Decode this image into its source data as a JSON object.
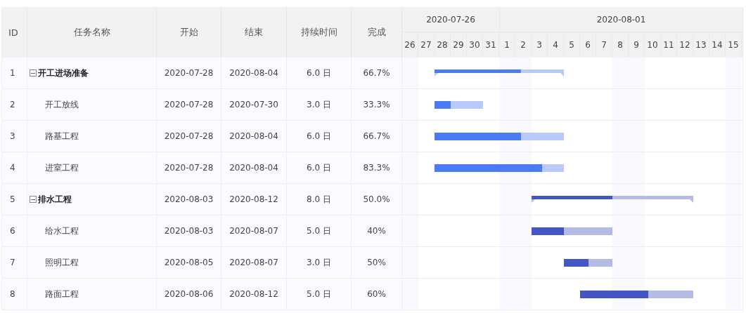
{
  "columns": [
    "ID",
    "任务名称",
    "开始",
    "结束",
    "持续时间",
    "完成"
  ],
  "timeline": {
    "weeks": [
      "2020-07-26",
      "2020-08-01"
    ],
    "days": [
      {
        "label": "26",
        "weekend": true
      },
      {
        "label": "27",
        "weekend": false
      },
      {
        "label": "28",
        "weekend": false
      },
      {
        "label": "29",
        "weekend": false
      },
      {
        "label": "30",
        "weekend": false
      },
      {
        "label": "31",
        "weekend": false
      },
      {
        "label": "1",
        "weekend": true
      },
      {
        "label": "2",
        "weekend": true
      },
      {
        "label": "3",
        "weekend": false
      },
      {
        "label": "4",
        "weekend": false
      },
      {
        "label": "5",
        "weekend": false
      },
      {
        "label": "6",
        "weekend": false
      },
      {
        "label": "7",
        "weekend": false
      },
      {
        "label": "8",
        "weekend": true
      },
      {
        "label": "9",
        "weekend": true
      },
      {
        "label": "10",
        "weekend": false
      },
      {
        "label": "11",
        "weekend": false
      },
      {
        "label": "12",
        "weekend": false
      },
      {
        "label": "13",
        "weekend": false
      },
      {
        "label": "14",
        "weekend": false
      },
      {
        "label": "15",
        "weekend": true
      }
    ]
  },
  "tasks": [
    {
      "id": "1",
      "name": "开工进场准备",
      "kind": "summary",
      "expanded": true,
      "start": "2020-07-28",
      "end": "2020-08-04",
      "duration": "6.0 日",
      "complete": "66.7%",
      "level": 0.667,
      "color": "#4a7bf5",
      "children": [
        {
          "id": "2",
          "name": "开工放线",
          "kind": "task",
          "start": "2020-07-28",
          "end": "2020-07-30",
          "duration": "3.0 日",
          "complete": "33.3%",
          "level": 0.333,
          "color": "#4a7bf5"
        },
        {
          "id": "3",
          "name": "路基工程",
          "kind": "task",
          "start": "2020-07-28",
          "end": "2020-08-04",
          "duration": "6.0 日",
          "complete": "66.7%",
          "level": 0.667,
          "color": "#4a7bf5"
        },
        {
          "id": "4",
          "name": "进室工程",
          "kind": "task",
          "start": "2020-07-28",
          "end": "2020-08-04",
          "duration": "6.0 日",
          "complete": "83.3%",
          "level": 0.833,
          "color": "#4a7bf5"
        }
      ]
    },
    {
      "id": "5",
      "name": "排水工程",
      "kind": "summary",
      "expanded": true,
      "start": "2020-08-03",
      "end": "2020-08-12",
      "duration": "8.0 日",
      "complete": "50.0%",
      "level": 0.5,
      "color": "#4356c4",
      "children": [
        {
          "id": "6",
          "name": "给水工程",
          "kind": "task",
          "start": "2020-08-03",
          "end": "2020-08-07",
          "duration": "5.0 日",
          "complete": "40%",
          "level": 0.4,
          "color": "#4356c4"
        },
        {
          "id": "7",
          "name": "照明工程",
          "kind": "task",
          "start": "2020-08-05",
          "end": "2020-08-07",
          "duration": "3.0 日",
          "complete": "50%",
          "level": 0.5,
          "color": "#4356c4"
        },
        {
          "id": "8",
          "name": "路面工程",
          "kind": "task",
          "start": "2020-08-06",
          "end": "2020-08-12",
          "duration": "5.0 日",
          "complete": "60%",
          "level": 0.6,
          "color": "#4356c4"
        }
      ]
    }
  ]
}
